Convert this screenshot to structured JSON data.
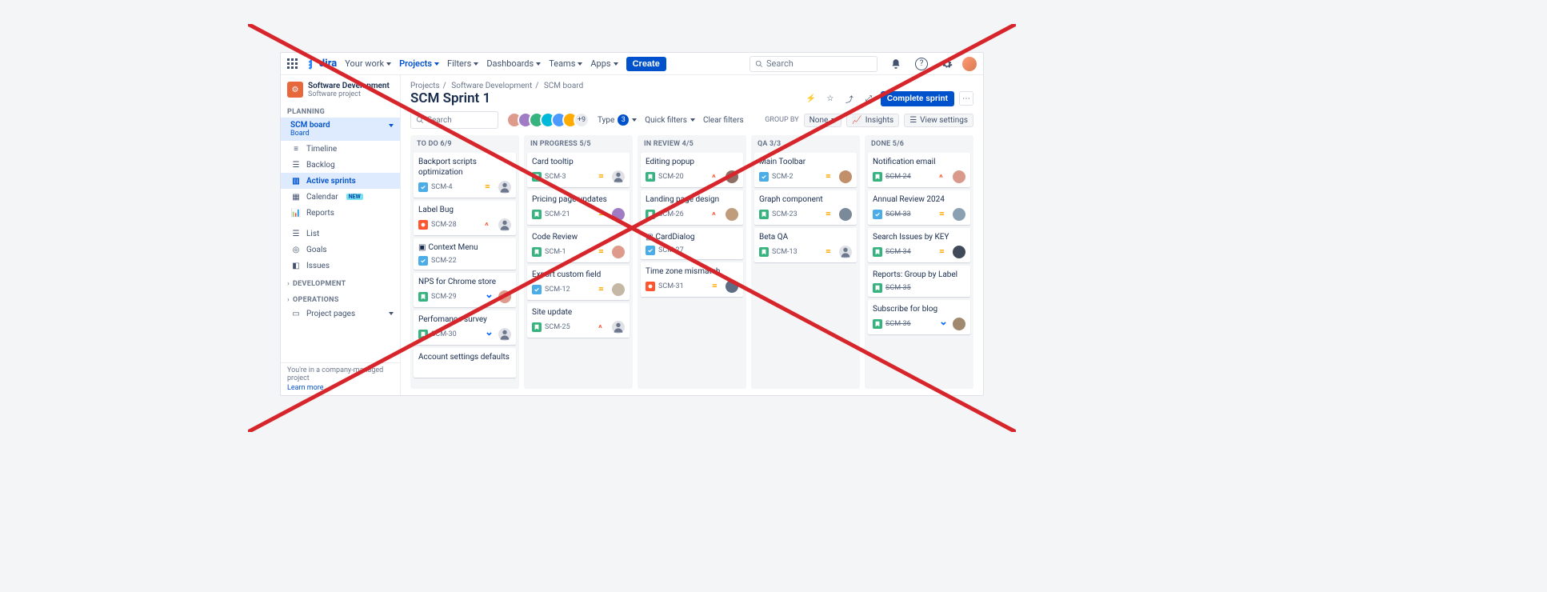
{
  "topnav": {
    "logo": "Jira",
    "items": [
      "Your work",
      "Projects",
      "Filters",
      "Dashboards",
      "Teams",
      "Apps"
    ],
    "active_index": 1,
    "create_label": "Create",
    "search_placeholder": "Search"
  },
  "sidebar": {
    "project_name": "Software Development",
    "project_subtitle": "Software project",
    "sections": {
      "planning_label": "PLANNING",
      "board": {
        "name": "SCM board",
        "sub": "Board"
      },
      "items": [
        {
          "label": "Timeline",
          "icon": "timeline"
        },
        {
          "label": "Backlog",
          "icon": "backlog"
        },
        {
          "label": "Active sprints",
          "icon": "board",
          "active": true
        },
        {
          "label": "Calendar",
          "icon": "calendar",
          "badge": "NEW"
        },
        {
          "label": "Reports",
          "icon": "reports"
        }
      ],
      "items2": [
        {
          "label": "List",
          "icon": "list"
        },
        {
          "label": "Goals",
          "icon": "goals"
        },
        {
          "label": "Issues",
          "icon": "issues"
        }
      ],
      "dev_label": "DEVELOPMENT",
      "ops_label": "OPERATIONS",
      "pages_label": "Project pages"
    },
    "footer_text": "You're in a company-managed project",
    "footer_link": "Learn more"
  },
  "header": {
    "breadcrumbs": [
      "Projects",
      "Software Development",
      "SCM board"
    ],
    "title": "SCM Sprint 1",
    "complete_label": "Complete sprint"
  },
  "filters": {
    "search_placeholder": "Search",
    "avatar_overflow": "+9",
    "type_label": "Type",
    "type_count": "3",
    "quick_label": "Quick filters",
    "clear_label": "Clear filters",
    "group_label": "GROUP BY",
    "group_value": "None",
    "insights_label": "Insights",
    "viewset_label": "View settings"
  },
  "columns": [
    {
      "header": "TO DO 6/9",
      "cards": [
        {
          "title": "Backport scripts optimization",
          "key": "SCM-4",
          "type": "task",
          "prio": "medium",
          "assignee": "un"
        },
        {
          "title": "Label Bug",
          "key": "SCM-28",
          "type": "bug",
          "prio": "high",
          "assignee": "un"
        },
        {
          "title": "Context Menu",
          "key": "SCM-22",
          "type": "task",
          "prio": "",
          "assignee": "",
          "epic": "menu"
        },
        {
          "title": "NPS for Chrome store",
          "key": "SCM-29",
          "type": "story",
          "prio": "low",
          "assignee": "p1"
        },
        {
          "title": "Perfomance survey",
          "key": "SCM-30",
          "type": "story",
          "prio": "low",
          "assignee": "un"
        },
        {
          "title": "Account settings defaults",
          "key": "",
          "type": "",
          "prio": "",
          "assignee": ""
        }
      ]
    },
    {
      "header": "IN PROGRESS 5/5",
      "cards": [
        {
          "title": "Card tooltip",
          "key": "SCM-3",
          "type": "story",
          "prio": "medium",
          "assignee": "un"
        },
        {
          "title": "Pricing page updates",
          "key": "SCM-21",
          "type": "story",
          "prio": "medium",
          "assignee": "p2"
        },
        {
          "title": "Code Review",
          "key": "SCM-1",
          "type": "story",
          "prio": "medium",
          "assignee": "p3",
          "flag": true
        },
        {
          "title": "Export custom field",
          "key": "SCM-12",
          "type": "task",
          "prio": "medium",
          "assignee": "p4"
        },
        {
          "title": "Site update",
          "key": "SCM-25",
          "type": "story",
          "prio": "high",
          "assignee": "un"
        }
      ]
    },
    {
      "header": "IN REVIEW 4/5",
      "cards": [
        {
          "title": "Editing popup",
          "key": "SCM-20",
          "type": "story",
          "prio": "high",
          "assignee": "p5"
        },
        {
          "title": "Landing page design",
          "key": "SCM-26",
          "type": "story",
          "prio": "high",
          "assignee": "p6"
        },
        {
          "title": "CardDialog",
          "key": "SCM-27",
          "type": "task",
          "prio": "",
          "assignee": "",
          "epic": "dialog"
        },
        {
          "title": "Time zone mismatch",
          "key": "SCM-31",
          "type": "bug",
          "prio": "medium",
          "assignee": "p7"
        }
      ]
    },
    {
      "header": "QA 3/3",
      "cards": [
        {
          "title": "Main Toolbar",
          "key": "SCM-2",
          "type": "task",
          "prio": "medium",
          "assignee": "p8"
        },
        {
          "title": "Graph component",
          "key": "SCM-23",
          "type": "story",
          "prio": "medium",
          "assignee": "p9"
        },
        {
          "title": "Beta QA",
          "key": "SCM-13",
          "type": "story",
          "prio": "medium",
          "assignee": "un"
        }
      ]
    },
    {
      "header": "DONE 5/6",
      "cards": [
        {
          "title": "Notification email",
          "key": "SCM-24",
          "type": "story",
          "prio": "high",
          "assignee": "p10",
          "done": true
        },
        {
          "title": "Annual Review 2024",
          "key": "SCM-33",
          "type": "task",
          "prio": "medium",
          "assignee": "p11",
          "done": true
        },
        {
          "title": "Search Issues by KEY",
          "key": "SCM-34",
          "type": "story",
          "prio": "medium",
          "assignee": "p12",
          "done": true
        },
        {
          "title": "Reports: Group by Label",
          "key": "SCM-35",
          "type": "story",
          "prio": "",
          "assignee": "",
          "done": true
        },
        {
          "title": "Subscribe for blog",
          "key": "SCM-36",
          "type": "story",
          "prio": "low",
          "assignee": "p13",
          "done": true
        }
      ]
    }
  ],
  "avatar_colors": [
    "#de9b8c",
    "#a07cc5",
    "#36b37e",
    "#00b8d9",
    "#4c9aff",
    "#ffab00"
  ]
}
